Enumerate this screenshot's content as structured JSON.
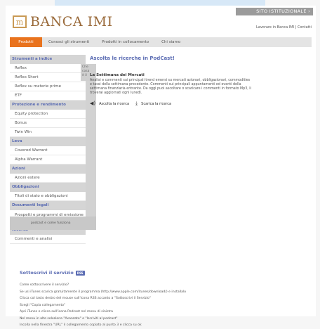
{
  "top_button": "SITO ISTITUZIONALE  ›",
  "logo": {
    "mark": "m",
    "text": "BANCA IMI"
  },
  "header_links": "Lavorare in Banca IMI  |  Contatti",
  "nav": [
    "Prodotti",
    "Conosci gli strumenti",
    "Prodotti in collocamento",
    "Chi siamo"
  ],
  "sidebar": [
    {
      "header": "Strumenti a indice",
      "items": [
        "Reflex",
        "Reflex Short",
        "Reflex su materie prime",
        "ETF"
      ]
    },
    {
      "header": "Protezione e rendimento",
      "items": [
        "Equity protection",
        "Bonus",
        "Twin Win"
      ]
    },
    {
      "header": "Leva",
      "items": [
        "Covered Warrant",
        "Alpha Warrant"
      ]
    },
    {
      "header": "Azioni",
      "items": [
        "Azioni estere"
      ]
    },
    {
      "header": "Obbligazioni",
      "items": [
        "Titoli di stato e obbligazioni"
      ]
    },
    {
      "header": "Documenti legali",
      "items": [
        "Prospetti e programmi di emissione"
      ]
    },
    {
      "header": "Ricerca",
      "items": [
        "Commenti e analisi"
      ]
    }
  ],
  "sub_menu": [
    "Che",
    "cosa",
    "è il"
  ],
  "sidebar_footer": "podcast e come funziona",
  "content": {
    "title": "Ascolta le ricerche in PodCast!",
    "subtitle": "La Settimana dei Mercati",
    "description": "Analisi e commenti sui principali trend emersi su mercati azionari, obbligazionari, commodities e tassi della settimana precedente. Commenti sui principali appuntamenti ed eventi della settimana finanziaria entrante. Da oggi puoi ascoltare o scaricare i commenti in formato Mp3, li troverai aggiornati ogni lunedì.",
    "listen": "Ascolta la ricerca",
    "download": "Scarica la ricerca"
  },
  "subscribe": {
    "label": "Sottoscrivi il servizio",
    "badge": "RSS"
  },
  "steps": [
    "Come sottoscrivere il servizio?",
    "Se usi iTunes scarica gratuitamente il programma (http://www.apple.com/itunes/download/) e installalo",
    "Clicca col tasto destro del mouse sull'icona RSS accanto a \"Sottoscrivi il Servizio\"",
    "Scegli \"Copia collegamento\"",
    "Apri iTunes e clicca sull'icona Podcast nel menu di sinistra",
    "Nel menu in alto seleziona \"Avanzate\" e \"Iscriviti al podcast\"",
    "Incolla nella finestra \"URL\" il collegamento copiato al punto 3 e clicca su ok"
  ]
}
